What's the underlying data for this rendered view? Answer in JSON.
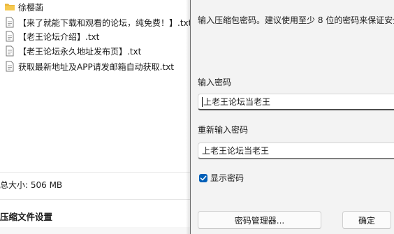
{
  "file_list": {
    "items": [
      {
        "type": "folder",
        "icon": "folder-icon",
        "label": "徐樱菡"
      },
      {
        "type": "file",
        "icon": "text-file-icon",
        "label": "【来了就能下载和观看的论坛，纯免费！】.txt"
      },
      {
        "type": "file",
        "icon": "text-file-icon",
        "label": "【老王论坛介绍】.txt"
      },
      {
        "type": "file",
        "icon": "text-file-icon",
        "label": "【老王论坛永久地址发布页】.txt"
      },
      {
        "type": "file",
        "icon": "text-file-icon",
        "label": "获取最新地址及APP请发邮箱自动获取.txt"
      }
    ],
    "total_size": "总大小: 506 MB",
    "section_title": "压缩文件设置"
  },
  "password_dialog": {
    "description": "输入压缩包密码。建议使用至少 8 位的密码来保证安全",
    "password_label": "输入密码",
    "password_value": "上老王论坛当老王",
    "reenter_label": "重新输入密码",
    "reenter_value": "上老王论坛当老王",
    "show_password_label": "显示密码",
    "show_password_checked": true,
    "manager_button": "密码管理器...",
    "ok_button": "确定"
  },
  "colors": {
    "accent": "#005fb8",
    "folder": "#e8b43a",
    "dialog_bg": "#f3f3f3"
  }
}
